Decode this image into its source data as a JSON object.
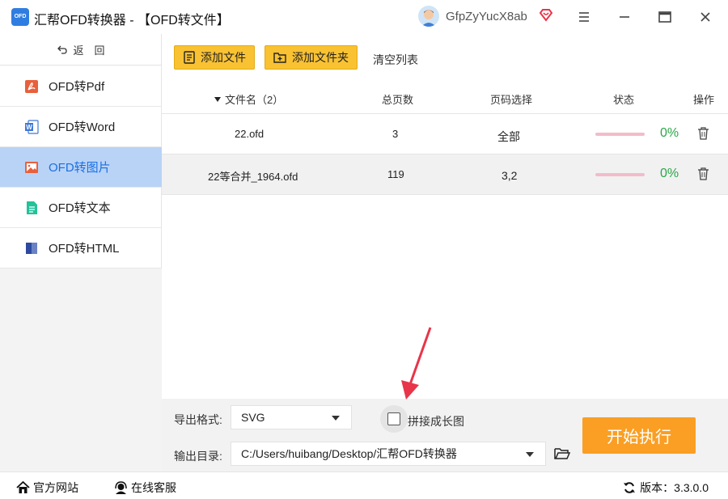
{
  "app": {
    "logo_text": "OFD",
    "title": "汇帮OFD转换器 - 【OFD转文件】",
    "username": "GfpZyYucX8ab"
  },
  "icons": {
    "window": [
      "menu-icon",
      "minimize-icon",
      "maximize-icon",
      "close-icon"
    ],
    "vip": "diamond-heart-icon"
  },
  "sidebar": {
    "back_label": "返　回",
    "items": [
      {
        "label": "OFD转Pdf",
        "icon": "pdf-icon",
        "color": "#e8603c",
        "active": false
      },
      {
        "label": "OFD转Word",
        "icon": "word-icon",
        "color": "#3f78d6",
        "active": false
      },
      {
        "label": "OFD转图片",
        "icon": "image-icon",
        "color": "#e8603c",
        "active": true
      },
      {
        "label": "OFD转文本",
        "icon": "text-icon",
        "color": "#22c29a",
        "active": false
      },
      {
        "label": "OFD转HTML",
        "icon": "html-icon",
        "color": "#2d4aa0",
        "active": false
      }
    ]
  },
  "toolbar": {
    "add_file": "添加文件",
    "add_folder": "添加文件夹",
    "clear": "清空列表"
  },
  "table": {
    "headers": {
      "filename": "文件名（2）",
      "pages": "总页数",
      "page_select": "页码选择",
      "status": "状态",
      "action": "操作"
    },
    "rows": [
      {
        "filename": "22.ofd",
        "pages": "3",
        "page_select": "全部",
        "progress": 0,
        "percent": "0%"
      },
      {
        "filename": "22等合并_1964.ofd",
        "pages": "119",
        "page_select": "3,2",
        "progress": 0,
        "percent": "0%"
      }
    ]
  },
  "options": {
    "format_label": "导出格式:",
    "format_value": "SVG",
    "merge_label": "拼接成长图",
    "merge_checked": false,
    "output_label": "输出目录:",
    "output_value": "C:/Users/huibang/Desktop/汇帮OFD转换器",
    "start_button": "开始执行"
  },
  "statusbar": {
    "website": "官方网站",
    "support": "在线客服",
    "version": "版本：3.3.0.0"
  },
  "colors": {
    "accent_yellow": "#f9c232",
    "start_orange": "#fa9f23",
    "active_nav_bg": "#b9d3f7",
    "active_nav_text": "#1a6fe0",
    "percent_green": "#2aa646",
    "annotation_red": "#e8354a"
  }
}
